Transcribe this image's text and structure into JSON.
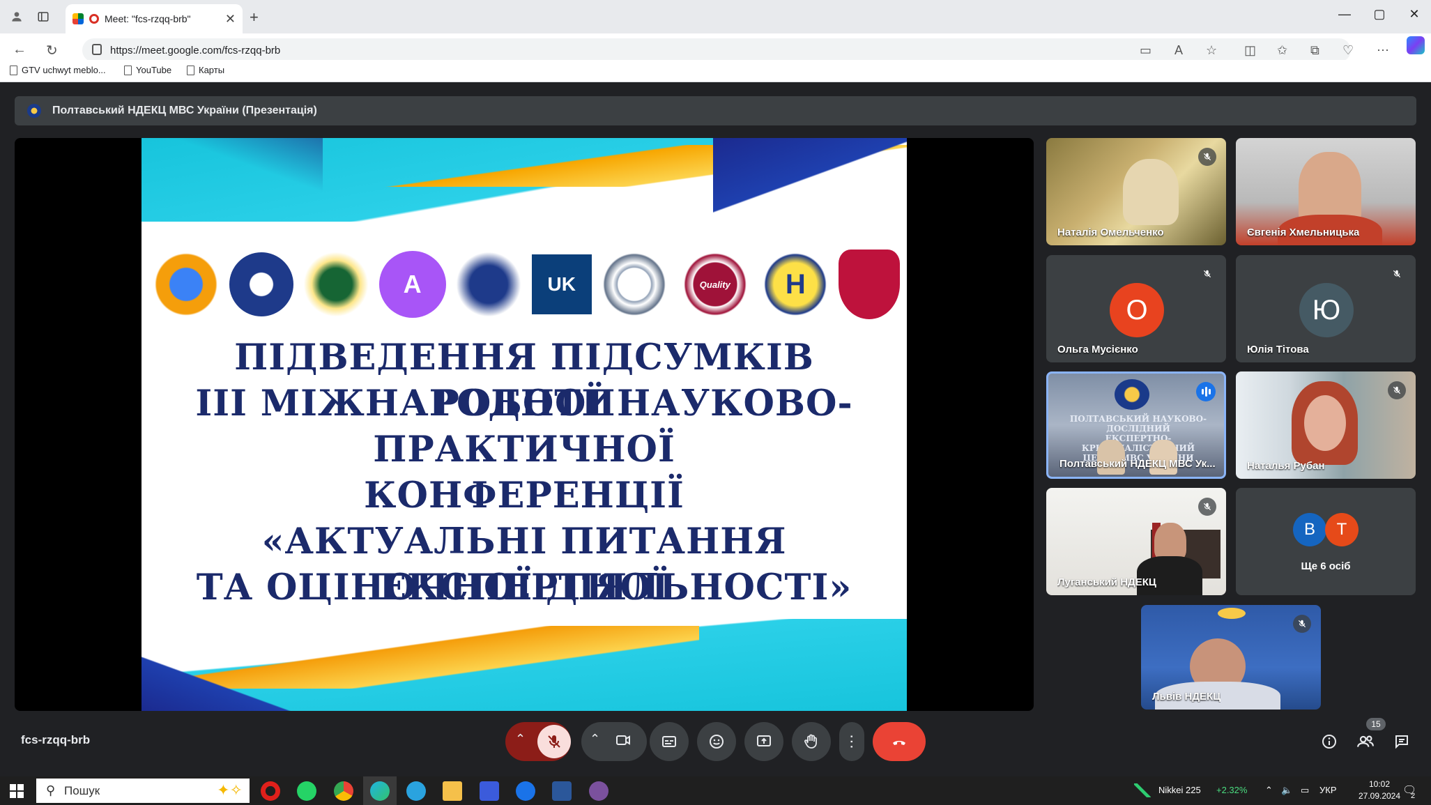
{
  "browser": {
    "tab_title": "Meet: \"fcs-rzqq-brb\"",
    "url": "https://meet.google.com/fcs-rzqq-brb",
    "bookmarks": [
      "GTV uchwyt meblo...",
      "YouTube",
      "Карты"
    ]
  },
  "meet": {
    "presentation_label": "Полтавський НДЕКЦ МВС України (Презентація)",
    "slide": {
      "lines": [
        "ПІДВЕДЕННЯ ПІДСУМКІВ РОБОТИ",
        "ІІІ МІЖНАРОДНОЇ НАУКОВО-",
        "ПРАКТИЧНОЇ",
        "КОНФЕРЕНЦІЇ",
        "«АКТУАЛЬНІ ПИТАННЯ ЕКСПЕРТНОЇ",
        "ТА ОЦІНОЧНОЇ ДІЯЛЬНОСТІ»"
      ],
      "logos": [
        "",
        "",
        "",
        "A",
        "",
        "UK",
        "",
        "Quality",
        "H",
        ""
      ]
    },
    "participants": [
      {
        "name": "Наталія Омельченко",
        "muted": true
      },
      {
        "name": "Євгенія Хмельницька",
        "muted": false
      },
      {
        "name": "Ольга Мусієнко",
        "muted": true,
        "initial": "О",
        "color": "#e8431f"
      },
      {
        "name": "Юлія Тітова",
        "muted": true,
        "initial": "Ю",
        "color": "#455a64"
      },
      {
        "name": "Полтавський НДЕКЦ МВС Ук...",
        "muted": false,
        "speaking": true
      },
      {
        "name": "Наталья Рубан",
        "muted": true
      },
      {
        "name": "Луганський НДЕКЦ",
        "muted": true
      },
      {
        "name": "Ще 6 осіб",
        "initials": [
          "В",
          "Т"
        ],
        "colors": [
          "#1565c0",
          "#e64a19"
        ]
      },
      {
        "name": "Львів НДЕКЦ",
        "muted": true
      }
    ],
    "meeting_code": "fcs-rzqq-brb",
    "people_count": "15"
  },
  "taskbar": {
    "search_placeholder": "Пошук",
    "stock_name": "Nikkei 225",
    "stock_change": "+2.32%",
    "language": "УКР",
    "time": "10:02",
    "date": "27.09.2024",
    "notifications": "2"
  }
}
